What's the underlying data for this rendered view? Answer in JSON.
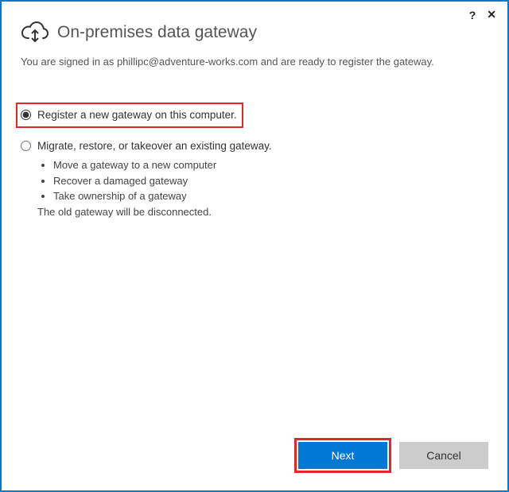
{
  "window": {
    "title": "On-premises data gateway",
    "help_symbol": "?",
    "close_symbol": "✕"
  },
  "signed_in": {
    "prefix": "You are signed in as ",
    "email": "phillipc@adventure-works.com",
    "suffix": " and are ready to register the gateway."
  },
  "options": {
    "register": {
      "label": "Register a new gateway on this computer.",
      "selected": true
    },
    "migrate": {
      "label": "Migrate, restore, or takeover an existing gateway.",
      "selected": false,
      "bullets": [
        "Move a gateway to a new computer",
        "Recover a damaged gateway",
        "Take ownership of a gateway"
      ],
      "note": "The old gateway will be disconnected."
    }
  },
  "footer": {
    "next_label": "Next",
    "cancel_label": "Cancel"
  }
}
